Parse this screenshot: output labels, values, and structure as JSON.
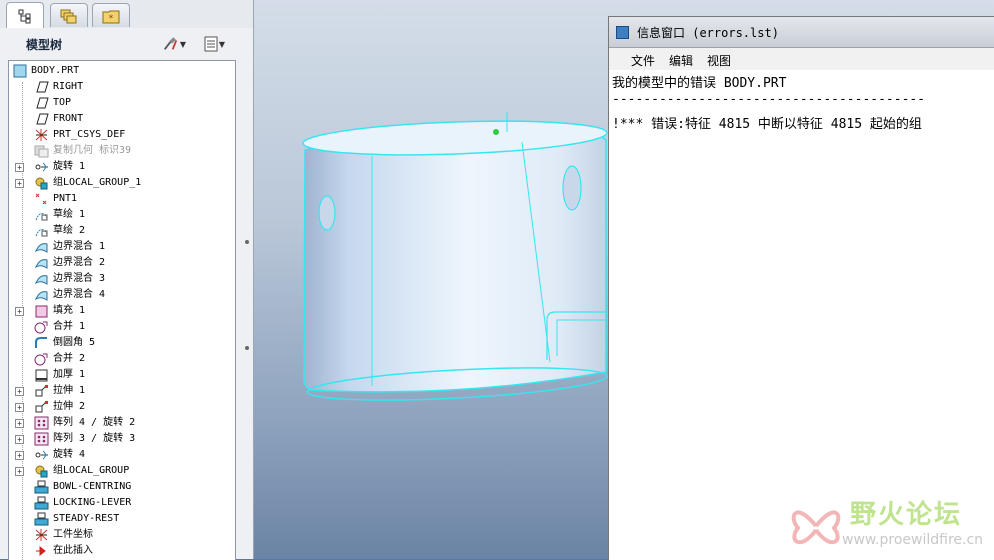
{
  "left_panel": {
    "tabs": [
      {
        "icon": "model-tree-icon",
        "active": true
      },
      {
        "icon": "layers-icon",
        "active": false
      },
      {
        "icon": "favorites-folder-icon",
        "active": false
      }
    ],
    "tree_title": "模型树",
    "settings_icon": "tools-icon",
    "show_icon": "list-icon"
  },
  "tree": {
    "root": "BODY.PRT",
    "items": [
      {
        "label": "RIGHT",
        "icon": "datum-plane-icon",
        "expandable": false,
        "grey": false
      },
      {
        "label": "TOP",
        "icon": "datum-plane-icon",
        "expandable": false,
        "grey": false
      },
      {
        "label": "FRONT",
        "icon": "datum-plane-icon",
        "expandable": false,
        "grey": false
      },
      {
        "label": "PRT_CSYS_DEF",
        "icon": "csys-icon",
        "expandable": false,
        "grey": false
      },
      {
        "label": "复制几何 标识39",
        "icon": "copy-geom-icon",
        "expandable": false,
        "grey": true
      },
      {
        "label": "旋转 1",
        "icon": "revolve-icon",
        "expandable": true,
        "grey": false
      },
      {
        "label": "组LOCAL_GROUP_1",
        "icon": "group-icon",
        "expandable": true,
        "grey": false
      },
      {
        "label": "PNT1",
        "icon": "datum-point-icon",
        "expandable": false,
        "grey": false
      },
      {
        "label": "草绘 1",
        "icon": "sketch-icon",
        "expandable": false,
        "grey": false
      },
      {
        "label": "草绘 2",
        "icon": "sketch-icon",
        "expandable": false,
        "grey": false
      },
      {
        "label": "边界混合 1",
        "icon": "boundary-blend-icon",
        "expandable": false,
        "grey": false
      },
      {
        "label": "边界混合 2",
        "icon": "boundary-blend-icon",
        "expandable": false,
        "grey": false
      },
      {
        "label": "边界混合 3",
        "icon": "boundary-blend-icon",
        "expandable": false,
        "grey": false
      },
      {
        "label": "边界混合 4",
        "icon": "boundary-blend-icon",
        "expandable": false,
        "grey": false
      },
      {
        "label": "填充 1",
        "icon": "fill-icon",
        "expandable": true,
        "grey": false
      },
      {
        "label": "合并 1",
        "icon": "merge-icon",
        "expandable": false,
        "grey": false
      },
      {
        "label": "倒圆角 5",
        "icon": "round-icon",
        "expandable": false,
        "grey": false
      },
      {
        "label": "合并 2",
        "icon": "merge-icon",
        "expandable": false,
        "grey": false
      },
      {
        "label": "加厚 1",
        "icon": "thicken-icon",
        "expandable": false,
        "grey": false
      },
      {
        "label": "拉伸 1",
        "icon": "extrude-icon",
        "expandable": true,
        "grey": false
      },
      {
        "label": "拉伸 2",
        "icon": "extrude-icon",
        "expandable": true,
        "grey": false
      },
      {
        "label": "阵列 4 / 旋转 2",
        "icon": "pattern-icon",
        "expandable": true,
        "grey": false
      },
      {
        "label": "阵列 3 / 旋转 3",
        "icon": "pattern-icon",
        "expandable": true,
        "grey": false
      },
      {
        "label": "旋转 4",
        "icon": "revolve-icon",
        "expandable": true,
        "grey": false
      },
      {
        "label": "组LOCAL_GROUP",
        "icon": "group-icon",
        "expandable": true,
        "grey": false
      },
      {
        "label": "BOWL-CENTRING",
        "icon": "component-icon",
        "expandable": false,
        "grey": false
      },
      {
        "label": "LOCKING-LEVER",
        "icon": "component-icon",
        "expandable": false,
        "grey": false
      },
      {
        "label": "STEADY-REST",
        "icon": "component-icon",
        "expandable": false,
        "grey": false
      },
      {
        "label": "工件坐标",
        "icon": "csys-icon",
        "expandable": false,
        "grey": false
      },
      {
        "label": "在此插入",
        "icon": "insert-arrow-icon",
        "expandable": false,
        "grey": false
      }
    ]
  },
  "info_window": {
    "title": "信息窗口 (errors.lst)",
    "menu": [
      "文件",
      "编辑",
      "视图"
    ],
    "lines": [
      "我的模型中的错误 BODY.PRT",
      "----------------------------------------",
      "!*** 错误:特征 4815 中断以特征 4815 起始的组"
    ]
  },
  "watermark": {
    "title": "野火论坛",
    "url": "www.proewildfire.cn"
  },
  "colors": {
    "model_edge": "#35e6f0",
    "model_surface": "#d9eaf8"
  }
}
